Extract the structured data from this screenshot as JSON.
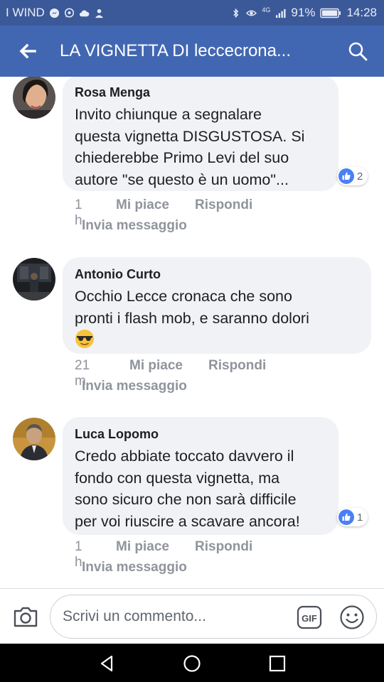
{
  "status_bar": {
    "carrier": "I WIND",
    "network_label": "4G",
    "battery": "91%",
    "time": "14:28",
    "icons": [
      "messenger-icon",
      "whatsapp-icon",
      "cloud-icon",
      "person-icon",
      "bluetooth-icon",
      "eye-icon",
      "signal-icon",
      "battery-icon"
    ]
  },
  "app_bar": {
    "title": "LA VIGNETTA DI leccecrona...",
    "color": "#4267b2"
  },
  "comments": [
    {
      "author": "Rosa Menga",
      "text": "Invito chiunque a segnalare\nquesta vignetta DISGUSTOSA. Si\nchiederebbe Primo Levi del suo\nautore \"se questo è un uomo\"...",
      "likes": "2",
      "time": "1 h",
      "like_label": "Mi piace",
      "reply_label": "Rispondi",
      "message_label": "Invia messaggio"
    },
    {
      "author": "Antonio Curto",
      "text": "Occhio Lecce cronaca che sono\npronti i flash mob, e saranno dolori",
      "emoji": "sunglasses-emoji",
      "time": "21 m",
      "like_label": "Mi piace",
      "reply_label": "Rispondi",
      "message_label": "Invia messaggio"
    },
    {
      "author": "Luca Lopomo",
      "text": "Credo abbiate toccato davvero il\nfondo con questa vignetta, ma\nsono sicuro che non sarà difficile\nper voi riuscire a scavare ancora!",
      "likes": "1",
      "time": "1 h",
      "like_label": "Mi piace",
      "reply_label": "Rispondi",
      "message_label": "Invia messaggio"
    }
  ],
  "composer": {
    "placeholder": "Scrivi un commento...",
    "gif_label": "GIF"
  },
  "colors": {
    "status_bar": "#3b5998",
    "bubble": "#f1f2f6",
    "like_blue": "#4a80f5",
    "meta_gray": "#90949c"
  }
}
